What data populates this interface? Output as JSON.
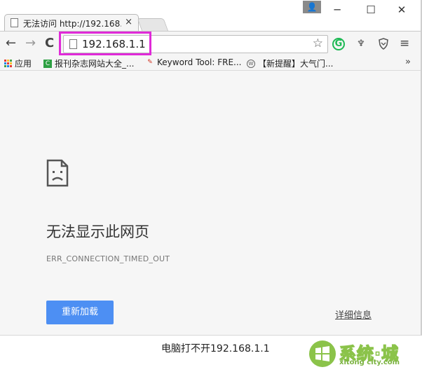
{
  "tab": {
    "title": "无法访问 http://192.168.",
    "close": "×"
  },
  "window_controls": {
    "profile": "👤",
    "minimize": "─",
    "maximize": "☐",
    "close": "✕"
  },
  "toolbar": {
    "back": "←",
    "forward": "→",
    "reload": "C",
    "url": "192.168.1.1",
    "star": "☆",
    "menu": "≡"
  },
  "bookmarks": {
    "items": [
      {
        "label": "应用"
      },
      {
        "label": "报刊杂志网站大全_..."
      },
      {
        "label": "Keyword Tool: FRE..."
      },
      {
        "label": "【新提醒】大气门..."
      }
    ],
    "more": "»"
  },
  "error": {
    "title": "无法显示此网页",
    "code": "ERR_CONNECTION_TIMED_OUT",
    "reload_label": "重新加载",
    "details_label": "详细信息"
  },
  "footer": {
    "caption": "电脑打不开192.168.1.1",
    "watermark_main": "系统·城",
    "watermark_sub": "xitong city.com"
  },
  "colors": {
    "highlight": "#e02ad8",
    "button": "#4d8ff3"
  }
}
